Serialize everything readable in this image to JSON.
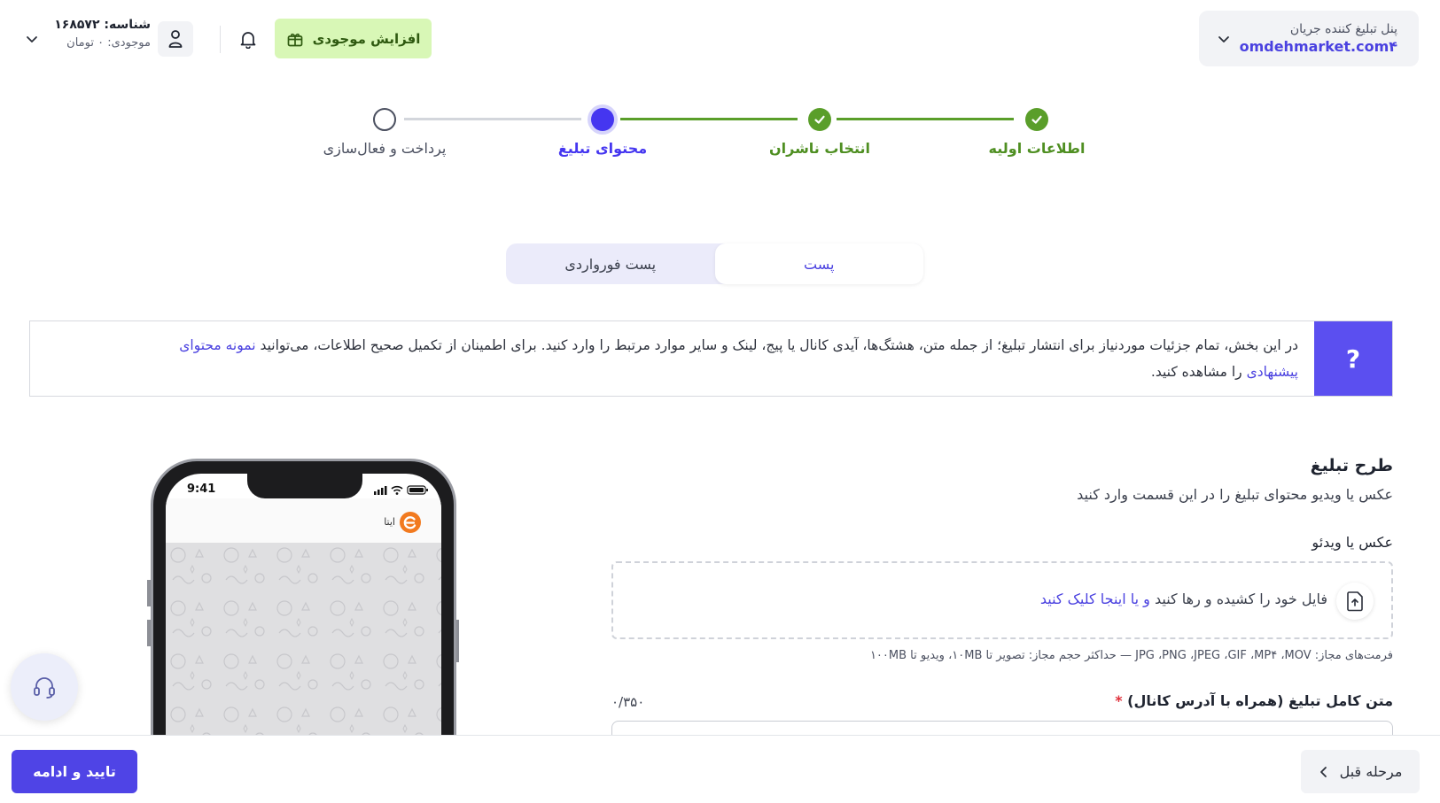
{
  "header": {
    "panel_label": "پنل تبلیغ کننده جریان",
    "panel_site": "omdehmarket.com۴",
    "topup_label": "افزایش موجودی",
    "user_id_label": "شناسه:",
    "user_id_value": "۱۶۸۵۷۲",
    "balance_text": "موجودی: ۰ تومان"
  },
  "stepper": {
    "steps": [
      {
        "label": "اطلاعات اولیه",
        "state": "done"
      },
      {
        "label": "انتخاب ناشران",
        "state": "done"
      },
      {
        "label": "محتوای تبلیغ",
        "state": "active"
      },
      {
        "label": "پرداخت و فعال‌سازی",
        "state": "todo"
      }
    ]
  },
  "tabs": [
    {
      "label": "پست",
      "active": true
    },
    {
      "label": "پست فورواردی",
      "active": false
    }
  ],
  "info": {
    "q_mark": "?",
    "text_part1": "در این بخش، تمام جزئیات موردنیاز برای انتشار تبلیغ؛ از جمله متن، هشتگ‌ها، آیدی کانال یا پیج، لینک و سایر موارد مرتبط را وارد کنید. برای اطمینان از تکمیل صحیح اطلاعات، می‌توانید",
    "link_text": "نمونه محتوای پیشنهادی",
    "text_part2": "را مشاهده کنید."
  },
  "form": {
    "section_title": "طرح تبلیغ",
    "section_subtitle": "عکس یا ویدیو محتوای تبلیغ را در این قسمت وارد کنید",
    "media_label": "عکس یا ویدئو",
    "dropzone_text": "فایل خود را کشیده و رها کنید",
    "dropzone_link": "و یا اینجا کلیک کنید",
    "formats_text": "فرمت‌های مجاز: JPG ،PNG ،JPEG ،GIF ،MP۴ ،MOV — حداکثر حجم مجاز: تصویر تا ۱۰MB، ویدیو تا ۱۰۰MB",
    "text_label": "متن کامل تبلیغ (همراه با آدرس کانال)",
    "required_mark": "*",
    "counter": "۰/۳۵۰"
  },
  "phone": {
    "time": "9:41",
    "app_name": "ایتا"
  },
  "footer": {
    "continue_label": "تایید و ادامه",
    "prev_label": "مرحله قبل"
  },
  "colors": {
    "accent": "#4f44e6",
    "success": "#5a9e2a",
    "topup_bg": "#d8f7b6"
  }
}
